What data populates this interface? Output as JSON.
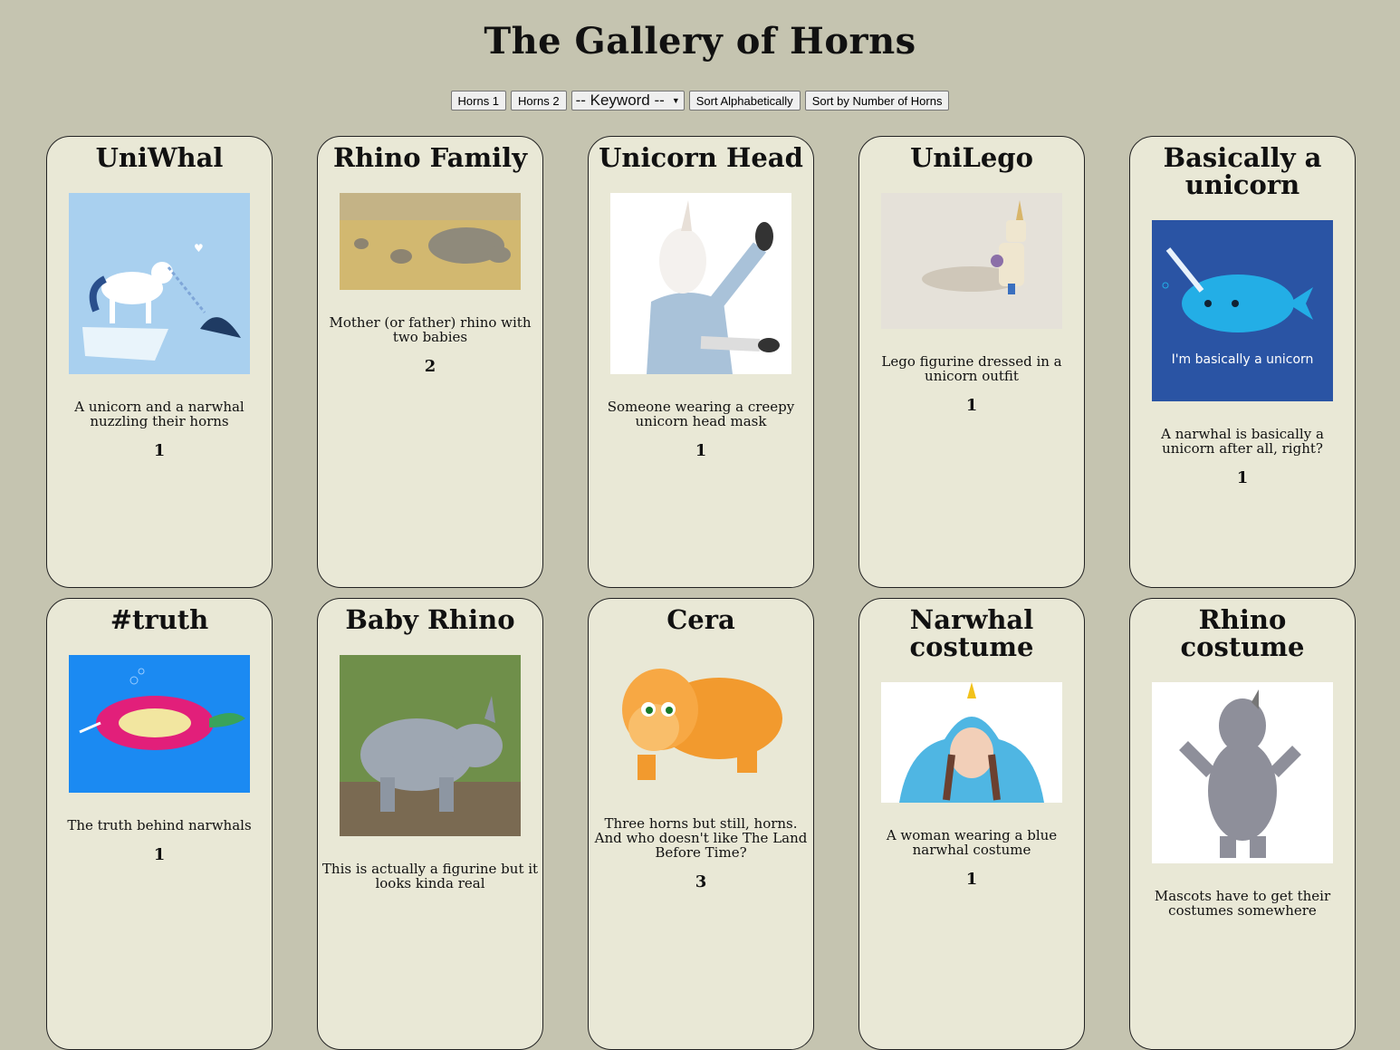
{
  "page": {
    "title": "The Gallery of Horns"
  },
  "controls": {
    "horns1_label": "Horns 1",
    "horns2_label": "Horns 2",
    "keyword_selected": "-- Keyword --",
    "sort_alpha_label": "Sort Alphabetically",
    "sort_horns_label": "Sort by Number of Horns"
  },
  "colors": {
    "background": "#c5c4b0",
    "card": "#e9e8d6",
    "border": "#222222"
  },
  "cards": [
    {
      "title": "UniWhal",
      "description": "A unicorn and a narwhal nuzzling their horns",
      "horns": "1",
      "image": "unicorn-narwhal-illustration"
    },
    {
      "title": "Rhino Family",
      "description": "Mother (or father) rhino with two babies",
      "horns": "2",
      "image": "rhino-family-photo"
    },
    {
      "title": "Unicorn Head",
      "description": "Someone wearing a creepy unicorn head mask",
      "horns": "1",
      "image": "unicorn-mask-photo"
    },
    {
      "title": "UniLego",
      "description": "Lego figurine dressed in a unicorn outfit",
      "horns": "1",
      "image": "lego-unicorn-photo"
    },
    {
      "title": "Basically a unicorn",
      "description": "A narwhal is basically a unicorn after all, right?",
      "horns": "1",
      "image": "narwhal-shirt-art",
      "image_caption": "I'm basically a unicorn"
    },
    {
      "title": "#truth",
      "description": "The truth behind narwhals",
      "horns": "1",
      "image": "narwhal-truth-drawing"
    },
    {
      "title": "Baby Rhino",
      "description": "This is actually a figurine but it looks kinda real",
      "horns": "",
      "image": "baby-rhino-figurine"
    },
    {
      "title": "Cera",
      "description": "Three horns but still, horns. And who doesn't like The Land Before Time?",
      "horns": "3",
      "image": "cera-triceratops"
    },
    {
      "title": "Narwhal costume",
      "description": "A woman wearing a blue narwhal costume",
      "horns": "1",
      "image": "narwhal-costume-photo"
    },
    {
      "title": "Rhino costume",
      "description": "Mascots have to get their costumes somewhere",
      "horns": "",
      "image": "rhino-mascot-photo"
    }
  ]
}
